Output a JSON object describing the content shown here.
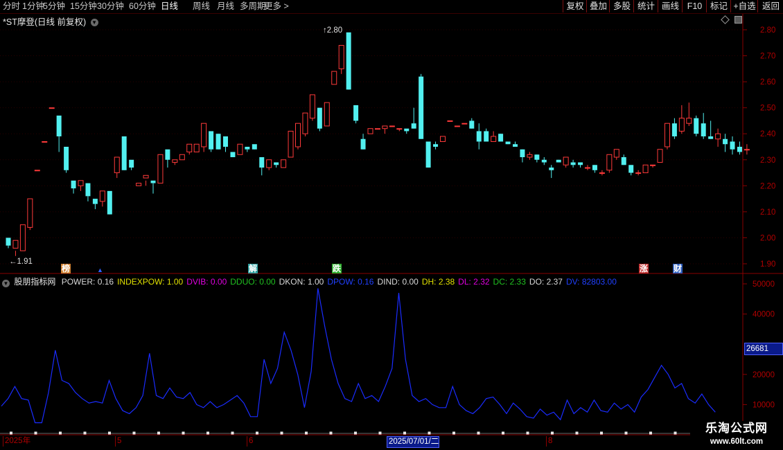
{
  "toolbar": {
    "periods": [
      "分时",
      "1分钟",
      "5分钟",
      "15分钟",
      "30分钟",
      "60分钟",
      "日线",
      "周线",
      "月线",
      "多周期",
      "更多 >"
    ],
    "active": "日线",
    "right_buttons": [
      "复权",
      "叠加",
      "多股",
      "统计",
      "画线",
      "F10",
      "标记",
      "+自选",
      "返回"
    ]
  },
  "header": {
    "title": "*ST摩登(日线 前复权)"
  },
  "price_axis": {
    "ticks": [
      "2.80",
      "2.70",
      "2.60",
      "2.50",
      "2.40",
      "2.30",
      "2.20",
      "2.10",
      "2.00",
      "1.90"
    ],
    "ymin": 1.9,
    "ymax": 2.8
  },
  "annotations": {
    "high": "2.80",
    "low": "1.91"
  },
  "events": [
    {
      "label": "榜",
      "color": "#d08030"
    },
    {
      "label": "解",
      "color": "#30a0a0"
    },
    {
      "label": "跌",
      "color": "#30b030"
    },
    {
      "label": "涨",
      "color": "#c03030"
    },
    {
      "label": "财",
      "color": "#3060c0"
    }
  ],
  "indicator": {
    "name": "股朋指标网",
    "items": [
      {
        "text": "POWER: 0.16",
        "color": "#d8d8d8"
      },
      {
        "text": "INDEXPOW: 1.00",
        "color": "#e0e000"
      },
      {
        "text": "DVIB: 0.00",
        "color": "#e000e0"
      },
      {
        "text": "DDUO: 0.00",
        "color": "#20c020"
      },
      {
        "text": "DKON: 1.00",
        "color": "#d8d8d8"
      },
      {
        "text": "DPOW: 0.16",
        "color": "#2040ff"
      },
      {
        "text": "DIND: 0.00",
        "color": "#d8d8d8"
      },
      {
        "text": "DH: 2.38",
        "color": "#e0e000"
      },
      {
        "text": "DL: 2.32",
        "color": "#e000e0"
      },
      {
        "text": "DC: 2.33",
        "color": "#20c020"
      },
      {
        "text": "DO: 2.37",
        "color": "#d8d8d8"
      },
      {
        "text": "DV: 82803.00",
        "color": "#2040ff"
      }
    ],
    "axis_ticks": [
      "50000",
      "40000",
      "20000",
      "10000"
    ],
    "current_value": "26681",
    "ymin": 0,
    "ymax": 50000
  },
  "date_axis": {
    "labels": [
      "2025年",
      "5",
      "6",
      "2025/07/01/二",
      "8"
    ]
  },
  "watermark": {
    "line1": "乐淘公式网",
    "line2": "www.60lt.com"
  },
  "chart_data": {
    "type": "candlestick",
    "candles": [
      [
        2.0,
        1.97,
        1.96,
        1.98
      ],
      [
        1.96,
        1.99,
        1.93,
        1.95
      ],
      [
        1.95,
        2.05,
        1.95,
        2.05
      ],
      [
        2.04,
        2.15,
        2.03,
        2.14
      ],
      [
        2.26,
        2.26,
        2.26,
        2.26
      ],
      [
        2.37,
        2.37,
        2.37,
        2.37
      ],
      [
        2.5,
        2.5,
        2.5,
        2.5
      ],
      [
        2.47,
        2.39,
        2.33,
        2.39
      ],
      [
        2.35,
        2.26,
        2.25,
        2.26
      ],
      [
        2.22,
        2.19,
        2.17,
        2.2
      ],
      [
        2.2,
        2.22,
        2.18,
        2.21
      ],
      [
        2.21,
        2.16,
        2.14,
        2.16
      ],
      [
        2.15,
        2.13,
        2.11,
        2.13
      ],
      [
        2.14,
        2.18,
        2.12,
        2.17
      ],
      [
        2.18,
        2.09,
        2.09,
        2.1
      ],
      [
        2.25,
        2.31,
        2.23,
        2.31
      ],
      [
        2.39,
        2.26,
        2.26,
        2.27
      ],
      [
        2.3,
        2.27,
        2.26,
        2.28
      ],
      [
        2.2,
        2.21,
        2.2,
        2.21
      ],
      [
        2.23,
        2.24,
        2.2,
        2.22
      ],
      [
        2.22,
        2.21,
        2.17,
        2.21
      ],
      [
        2.21,
        2.32,
        2.21,
        2.32
      ],
      [
        2.34,
        2.3,
        2.27,
        2.31
      ],
      [
        2.29,
        2.3,
        2.28,
        2.3
      ],
      [
        2.3,
        2.32,
        2.3,
        2.31
      ],
      [
        2.33,
        2.36,
        2.32,
        2.35
      ],
      [
        2.33,
        2.36,
        2.33,
        2.36
      ],
      [
        2.35,
        2.44,
        2.33,
        2.4
      ],
      [
        2.41,
        2.34,
        2.33,
        2.34
      ],
      [
        2.4,
        2.34,
        2.34,
        2.4
      ],
      [
        2.39,
        2.35,
        2.33,
        2.35
      ],
      [
        2.33,
        2.31,
        2.31,
        2.32
      ],
      [
        2.32,
        2.36,
        2.32,
        2.35
      ],
      [
        2.35,
        2.34,
        2.33,
        2.34
      ],
      [
        2.36,
        2.34,
        2.34,
        2.35
      ],
      [
        2.31,
        2.27,
        2.24,
        2.27
      ],
      [
        2.27,
        2.3,
        2.26,
        2.29
      ],
      [
        2.29,
        2.28,
        2.27,
        2.29
      ],
      [
        2.27,
        2.3,
        2.27,
        2.3
      ],
      [
        2.31,
        2.41,
        2.31,
        2.4
      ],
      [
        2.35,
        2.44,
        2.34,
        2.43
      ],
      [
        2.4,
        2.48,
        2.39,
        2.47
      ],
      [
        2.46,
        2.55,
        2.45,
        2.52
      ],
      [
        2.5,
        2.42,
        2.41,
        2.43
      ],
      [
        2.43,
        2.52,
        2.43,
        2.52
      ],
      [
        2.59,
        2.64,
        2.59,
        2.63
      ],
      [
        2.65,
        2.74,
        2.63,
        2.74
      ],
      [
        2.79,
        2.57,
        2.57,
        2.74
      ],
      [
        2.51,
        2.45,
        2.44,
        2.47
      ],
      [
        2.38,
        2.34,
        2.34,
        2.4
      ],
      [
        2.4,
        2.42,
        2.4,
        2.41
      ],
      [
        2.42,
        2.42,
        2.42,
        2.42
      ],
      [
        2.42,
        2.43,
        2.4,
        2.43
      ],
      [
        2.43,
        2.43,
        2.42,
        2.42
      ],
      [
        2.42,
        2.42,
        2.41,
        2.42
      ],
      [
        2.42,
        2.41,
        2.4,
        2.41
      ],
      [
        2.44,
        2.42,
        2.42,
        2.5
      ],
      [
        2.62,
        2.38,
        2.38,
        2.63
      ],
      [
        2.37,
        2.27,
        2.27,
        2.37
      ],
      [
        2.36,
        2.35,
        2.34,
        2.37
      ],
      [
        2.37,
        2.39,
        2.37,
        2.39
      ],
      [
        2.45,
        2.45,
        2.45,
        2.45
      ],
      [
        2.43,
        2.43,
        2.43,
        2.43
      ],
      [
        2.44,
        2.44,
        2.44,
        2.44
      ],
      [
        2.45,
        2.42,
        2.42,
        2.46
      ],
      [
        2.41,
        2.37,
        2.34,
        2.44
      ],
      [
        2.41,
        2.37,
        2.37,
        2.42
      ],
      [
        2.37,
        2.39,
        2.37,
        2.41
      ],
      [
        2.4,
        2.37,
        2.37,
        2.4
      ],
      [
        2.37,
        2.36,
        2.36,
        2.37
      ],
      [
        2.36,
        2.35,
        2.35,
        2.37
      ],
      [
        2.34,
        2.31,
        2.29,
        2.34
      ],
      [
        2.31,
        2.32,
        2.3,
        2.33
      ],
      [
        2.32,
        2.3,
        2.29,
        2.32
      ],
      [
        2.3,
        2.29,
        2.28,
        2.31
      ],
      [
        2.27,
        2.26,
        2.23,
        2.28
      ],
      [
        2.3,
        2.29,
        2.29,
        2.3
      ],
      [
        2.28,
        2.31,
        2.27,
        2.31
      ],
      [
        2.29,
        2.28,
        2.27,
        2.3
      ],
      [
        2.29,
        2.28,
        2.27,
        2.29
      ],
      [
        2.27,
        2.27,
        2.26,
        2.28
      ],
      [
        2.28,
        2.26,
        2.25,
        2.28
      ],
      [
        2.25,
        2.25,
        2.24,
        2.26
      ],
      [
        2.26,
        2.32,
        2.25,
        2.32
      ],
      [
        2.31,
        2.34,
        2.3,
        2.34
      ],
      [
        2.31,
        2.28,
        2.28,
        2.32
      ],
      [
        2.28,
        2.25,
        2.24,
        2.28
      ],
      [
        2.25,
        2.25,
        2.24,
        2.26
      ],
      [
        2.25,
        2.28,
        2.25,
        2.28
      ],
      [
        2.28,
        2.28,
        2.27,
        2.28
      ],
      [
        2.29,
        2.34,
        2.29,
        2.34
      ],
      [
        2.35,
        2.44,
        2.34,
        2.44
      ],
      [
        2.44,
        2.39,
        2.38,
        2.46
      ],
      [
        2.41,
        2.46,
        2.4,
        2.51
      ],
      [
        2.44,
        2.46,
        2.43,
        2.52
      ],
      [
        2.46,
        2.4,
        2.39,
        2.47
      ],
      [
        2.44,
        2.39,
        2.38,
        2.48
      ],
      [
        2.39,
        2.38,
        2.38,
        2.45
      ],
      [
        2.38,
        2.4,
        2.35,
        2.42
      ],
      [
        2.38,
        2.36,
        2.33,
        2.4
      ],
      [
        2.37,
        2.34,
        2.32,
        2.39
      ],
      [
        2.35,
        2.33,
        2.32,
        2.37
      ],
      [
        2.34,
        2.34,
        2.32,
        2.36
      ]
    ],
    "volume_line": [
      9500,
      12000,
      16000,
      12000,
      11500,
      4000,
      4000,
      14000,
      28000,
      18000,
      17000,
      14000,
      12000,
      10500,
      11000,
      10500,
      18000,
      12000,
      8000,
      7000,
      9000,
      13000,
      27000,
      13000,
      12000,
      15500,
      12500,
      12000,
      14000,
      10000,
      9000,
      11000,
      9000,
      10000,
      11500,
      13000,
      10500,
      6000,
      6000,
      25000,
      17000,
      22000,
      34000,
      28000,
      20000,
      9000,
      21000,
      48500,
      36000,
      25000,
      17000,
      12000,
      11000,
      17000,
      12000,
      13000,
      11000,
      16000,
      22000,
      47000,
      25000,
      13000,
      11000,
      12000,
      10000,
      9000,
      9000,
      16000,
      10000,
      8000,
      7000,
      9000,
      12000,
      12500,
      10000,
      7000,
      10500,
      8500,
      6000,
      5500,
      8500,
      6500,
      7500,
      5000,
      11500,
      7000,
      9000,
      7500,
      11500,
      8000,
      7500,
      10500,
      8500,
      10000,
      7500,
      12500,
      15000,
      19000,
      23000,
      20000,
      15500,
      17000,
      12000,
      10500,
      13500,
      10000,
      7500
    ]
  }
}
